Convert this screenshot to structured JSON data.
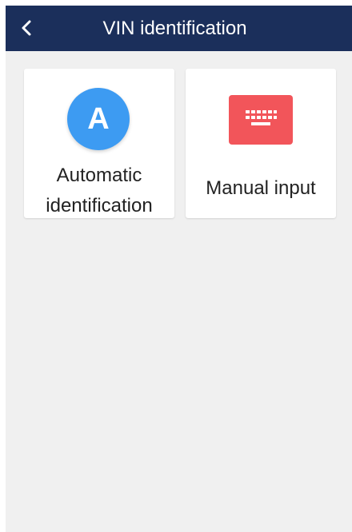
{
  "header": {
    "title": "VIN identification",
    "back_icon": "chevron-left-icon"
  },
  "options": [
    {
      "label_line1": "Automatic",
      "label_line2": "identification",
      "icon_letter": "A",
      "icon": "letter-a-circle-icon",
      "icon_color": "#3d9bf2"
    },
    {
      "label": "Manual input",
      "icon": "keyboard-icon",
      "icon_color": "#f2555a"
    }
  ],
  "colors": {
    "header_bg": "#1b2f5b",
    "page_bg": "#f0f0f0",
    "card_bg": "#ffffff"
  }
}
